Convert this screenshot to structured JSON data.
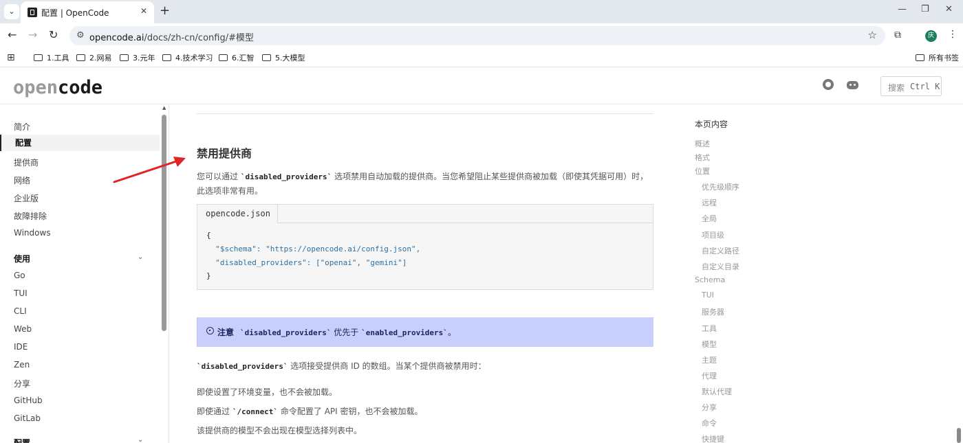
{
  "browser": {
    "tab_title": "配置 | OpenCode",
    "tab_close": "✕",
    "new_tab": "+",
    "url_host": "opencode.ai",
    "url_path": "/docs/zh-cn/config/#模型",
    "profile_initial": "庆",
    "bookmarks": [
      "1.工具",
      "2.网易",
      "3.元年",
      "4.技术学习",
      "6.汇智",
      "5.大模型"
    ],
    "all_bookmarks": "所有书签"
  },
  "header": {
    "logo_light": "open",
    "logo_dark": "code",
    "search_label": "搜索",
    "search_shortcut": "Ctrl K"
  },
  "sidebar": {
    "items": [
      "简介",
      "配置",
      "提供商",
      "网络",
      "企业版",
      "故障排除",
      "Windows"
    ],
    "active_item": "配置",
    "group_usage": "使用",
    "usage_items": [
      "Go",
      "TUI",
      "CLI",
      "Web",
      "IDE",
      "Zen",
      "分享",
      "GitHub",
      "GitLab"
    ],
    "group_config": "配置"
  },
  "content": {
    "heading": "禁用提供商",
    "intro_before": "您可以通过 ",
    "intro_code": "`disabled_providers`",
    "intro_after": " 选项禁用自动加载的提供商。当您希望阻止某些提供商被加载（即使其凭据可用）时，此选项非常有用。",
    "code_tab": "opencode.json",
    "code_lines": [
      "{",
      "  \"$schema\": \"https://opencode.ai/config.json\",",
      "  \"disabled_providers\": [\"openai\", \"gemini\"]",
      "}"
    ],
    "callout_title": "注意",
    "callout_code1": "`disabled_providers`",
    "callout_mid": " 优先于 ",
    "callout_code2": "`enabled_providers`",
    "callout_end": "。",
    "p2_code": "`disabled_providers`",
    "p2_text": " 选项接受提供商 ID 的数组。当某个提供商被禁用时：",
    "p3": "即使设置了环境变量，也不会被加载。",
    "p4_before": "即使通过 ",
    "p4_code": "`/connect`",
    "p4_after": " 命令配置了 API 密钥，也不会被加载。",
    "p5": "该提供商的模型不会出现在模型选择列表中。"
  },
  "toc": {
    "title": "本页内容",
    "items": [
      {
        "label": "概述",
        "level": 1
      },
      {
        "label": "格式",
        "level": 1
      },
      {
        "label": "位置",
        "level": 1
      },
      {
        "label": "优先级顺序",
        "level": 2
      },
      {
        "label": "远程",
        "level": 2
      },
      {
        "label": "全局",
        "level": 2
      },
      {
        "label": "项目级",
        "level": 2
      },
      {
        "label": "自定义路径",
        "level": 2
      },
      {
        "label": "自定义目录",
        "level": 2
      },
      {
        "label": "Schema",
        "level": 1
      },
      {
        "label": "TUI",
        "level": 2
      },
      {
        "label": "服务器",
        "level": 2
      },
      {
        "label": "工具",
        "level": 2
      },
      {
        "label": "模型",
        "level": 2
      },
      {
        "label": "主题",
        "level": 2
      },
      {
        "label": "代理",
        "level": 2
      },
      {
        "label": "默认代理",
        "level": 2
      },
      {
        "label": "分享",
        "level": 2
      },
      {
        "label": "命令",
        "level": 2
      },
      {
        "label": "快捷键",
        "level": 2
      }
    ]
  },
  "colors": {
    "callout_bg": "#c9cffb",
    "annotation_arrow": "#e02424",
    "profile_bg": "#1e7f5c"
  }
}
